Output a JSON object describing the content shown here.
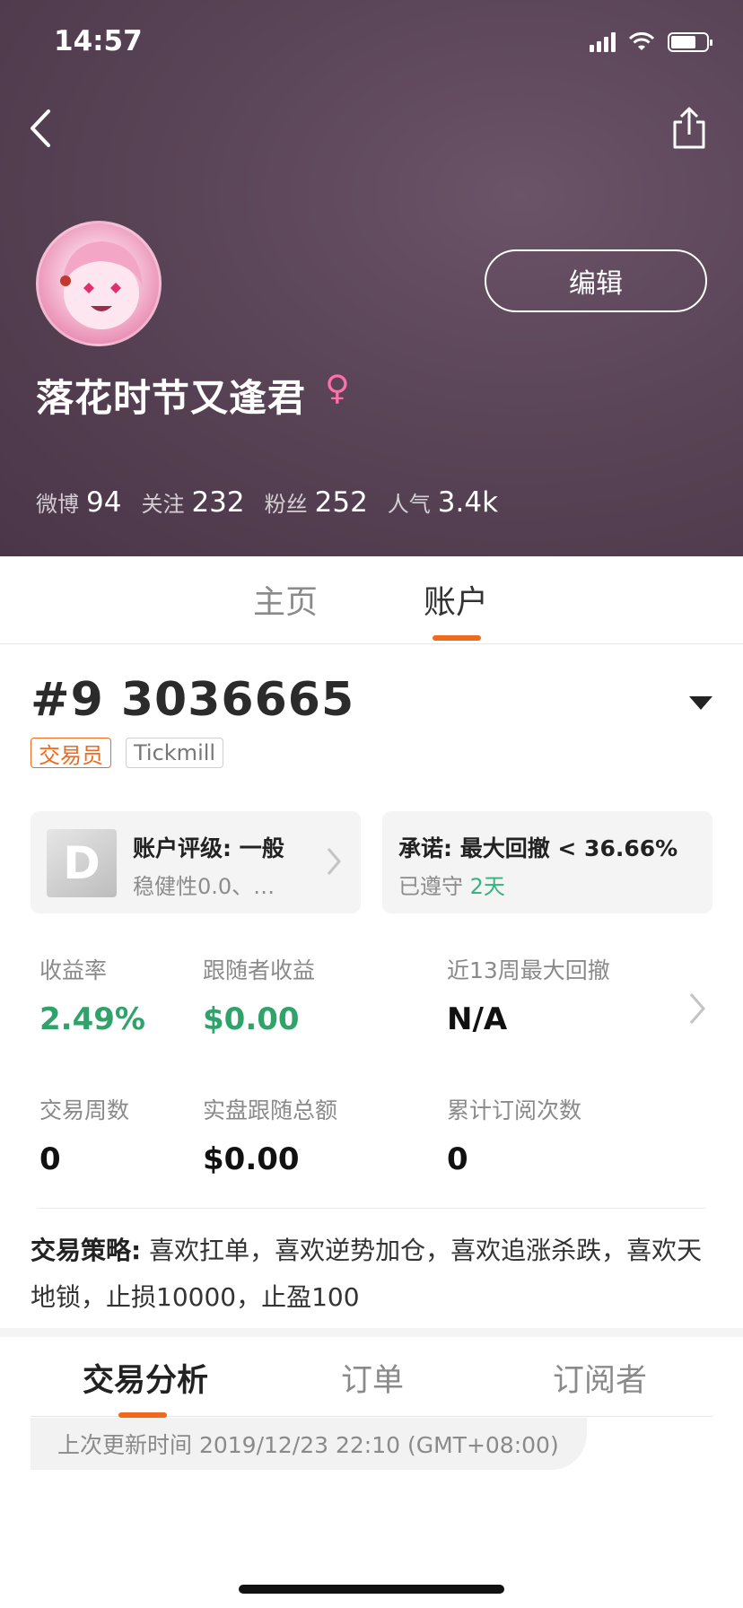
{
  "status_bar": {
    "time": "14:57"
  },
  "profile": {
    "edit_label": "编辑",
    "username": "落花时节又逢君",
    "gender_symbol": "♀",
    "stats": [
      {
        "label": "微博",
        "value": "94"
      },
      {
        "label": "关注",
        "value": "232"
      },
      {
        "label": "粉丝",
        "value": "252"
      },
      {
        "label": "人气",
        "value": "3.4k"
      }
    ]
  },
  "profile_tabs": [
    {
      "label": "主页",
      "active": false
    },
    {
      "label": "账户",
      "active": true
    }
  ],
  "account": {
    "id": "#9 3036665",
    "tags": [
      "交易员",
      "Tickmill"
    ],
    "rating_card": {
      "grade": "D",
      "title": "账户评级: 一般",
      "subtitle": "稳健性0.0、…"
    },
    "promise_card": {
      "title": "承诺: 最大回撤 < 36.66%",
      "status_prefix": "已遵守",
      "days": "2天"
    },
    "metrics": [
      {
        "label": "收益率",
        "value": "2.49%"
      },
      {
        "label": "跟随者收益",
        "value": "$0.00"
      },
      {
        "label": "近13周最大回撤",
        "value": "N/A"
      },
      {
        "label": "交易周数",
        "value": "0"
      },
      {
        "label": "实盘跟随总额",
        "value": "$0.00"
      },
      {
        "label": "累计订阅次数",
        "value": "0"
      }
    ],
    "strategy_label": "交易策略:",
    "strategy_text": "喜欢扛单，喜欢逆势加仓，喜欢追涨杀跌，喜欢天地锁，止损10000，止盈100"
  },
  "detail_tabs": [
    {
      "label": "交易分析",
      "active": true
    },
    {
      "label": "订单",
      "active": false
    },
    {
      "label": "订阅者",
      "active": false
    }
  ],
  "update_info": "上次更新时间 2019/12/23 22:10 (GMT+08:00)",
  "colors": {
    "accent": "#f06a1e",
    "positive": "#2fa36a",
    "hero_bg": "#5a4457",
    "gender": "#ff6fa8"
  }
}
